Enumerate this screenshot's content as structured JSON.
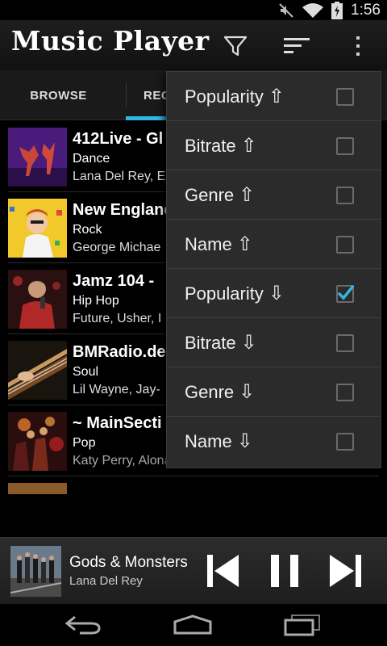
{
  "status_bar": {
    "time": "1:56",
    "icons": [
      "mute-icon",
      "wifi-icon",
      "battery-charging-icon"
    ]
  },
  "action_bar": {
    "title": "Music Player",
    "actions": [
      "filter-icon",
      "sort-icon",
      "overflow-menu-icon"
    ]
  },
  "tabs": [
    {
      "label": "BROWSE",
      "selected": false
    },
    {
      "label": "REC",
      "selected": true
    }
  ],
  "stations": [
    {
      "name": "412Live - Gl",
      "genre": "Dance",
      "artists": "Lana Del Rey, E"
    },
    {
      "name": "New England",
      "genre": "Rock",
      "artists": "George Michae"
    },
    {
      "name": "Jamz 104 -",
      "genre": "Hip Hop",
      "artists": "Future, Usher, I"
    },
    {
      "name": "BMRadio.de",
      "genre": "Soul",
      "artists": "Lil Wayne, Jay-"
    },
    {
      "name": "~ MainSecti",
      "genre": "Pop",
      "artists": "Katy Perry, Alona From Hell, Natali"
    }
  ],
  "sort_menu": {
    "items": [
      {
        "label": "Popularity",
        "arrow": "⇧",
        "checked": false
      },
      {
        "label": "Bitrate",
        "arrow": "⇧",
        "checked": false
      },
      {
        "label": "Genre",
        "arrow": "⇧",
        "checked": false
      },
      {
        "label": "Name",
        "arrow": "⇧",
        "checked": false
      },
      {
        "label": "Popularity",
        "arrow": "⇩",
        "checked": true
      },
      {
        "label": "Bitrate",
        "arrow": "⇩",
        "checked": false
      },
      {
        "label": "Genre",
        "arrow": "⇩",
        "checked": false
      },
      {
        "label": "Name",
        "arrow": "⇩",
        "checked": false
      }
    ]
  },
  "now_playing": {
    "title": "Gods & Monsters",
    "artist": "Lana Del Rey",
    "controls": [
      "previous-icon",
      "pause-icon",
      "next-icon"
    ]
  },
  "colors": {
    "accent": "#33b5e5",
    "menu_bg": "#2b2b2b"
  }
}
